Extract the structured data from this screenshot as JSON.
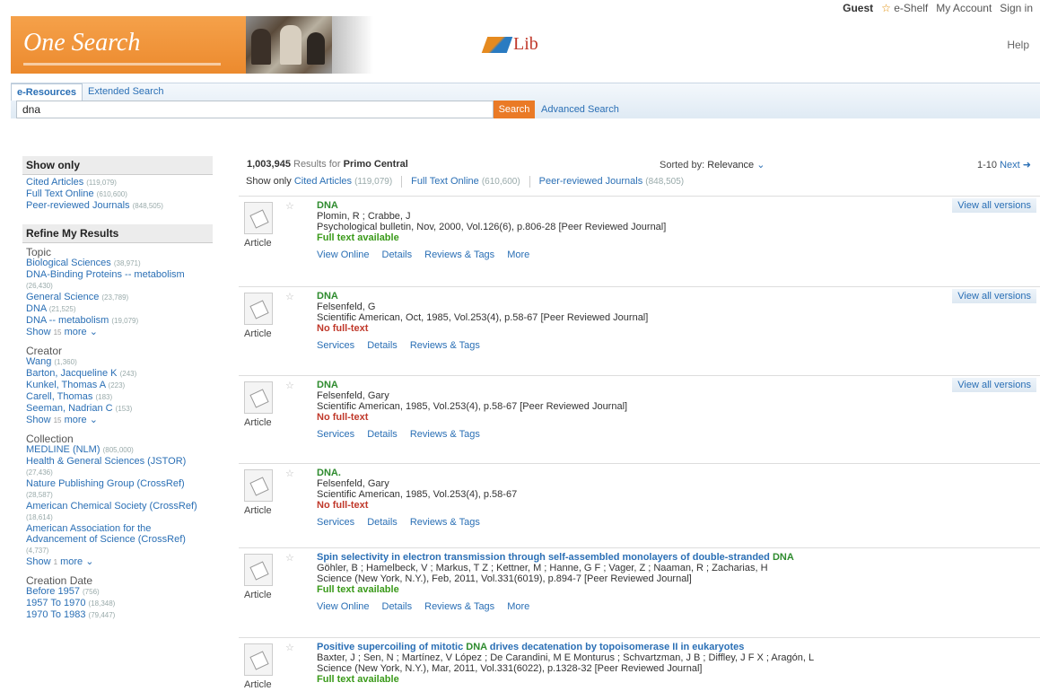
{
  "topnav": {
    "guest": "Guest",
    "eshelf": "e-Shelf",
    "account": "My Account",
    "signin": "Sign in",
    "help": "Help"
  },
  "banner": {
    "title": "One Search",
    "lib": "Lib"
  },
  "search": {
    "tabs": [
      "e-Resources",
      "Extended Search"
    ],
    "query": "dna",
    "button": "Search",
    "advanced": "Advanced Search"
  },
  "sidebar": {
    "show_only": {
      "title": "Show only",
      "items": [
        {
          "label": "Cited Articles",
          "count": "(119,079)"
        },
        {
          "label": "Full Text Online",
          "count": "(610,600)"
        },
        {
          "label": "Peer-reviewed Journals",
          "count": "(848,505)"
        }
      ]
    },
    "refine_title": "Refine My Results",
    "facets": [
      {
        "title": "Topic",
        "items": [
          {
            "label": "Biological Sciences",
            "count": "(38,971)"
          },
          {
            "label": "DNA-Binding Proteins -- metabolism",
            "count": "(26,430)"
          },
          {
            "label": "General Science",
            "count": "(23,789)"
          },
          {
            "label": "DNA",
            "count": "(21,525)"
          },
          {
            "label": "DNA -- metabolism",
            "count": "(19,079)"
          }
        ],
        "show": "Show",
        "n": "15",
        "more": "more"
      },
      {
        "title": "Creator",
        "items": [
          {
            "label": "Wang",
            "count": "(1,360)"
          },
          {
            "label": "Barton, Jacqueline K",
            "count": "(243)"
          },
          {
            "label": "Kunkel, Thomas A",
            "count": "(223)"
          },
          {
            "label": "Carell, Thomas",
            "count": "(183)"
          },
          {
            "label": "Seeman, Nadrian C",
            "count": "(153)"
          }
        ],
        "show": "Show",
        "n": "15",
        "more": "more"
      },
      {
        "title": "Collection",
        "items": [
          {
            "label": "MEDLINE (NLM)",
            "count": "(805,000)"
          },
          {
            "label": "Health & General Sciences (JSTOR)",
            "count": "(27,436)"
          },
          {
            "label": "Nature Publishing Group (CrossRef)",
            "count": "(28,587)"
          },
          {
            "label": "American Chemical Society (CrossRef)",
            "count": "(18,614)"
          },
          {
            "label": "American Association for the Advancement of Science (CrossRef)",
            "count": "(4,737)"
          }
        ],
        "show": "Show",
        "n": "1",
        "more": "more"
      },
      {
        "title": "Creation Date",
        "items": [
          {
            "label": "Before 1957",
            "count": "(756)"
          },
          {
            "label": "1957 To 1970",
            "count": "(18,348)"
          },
          {
            "label": "1970 To 1983",
            "count": "(79,447)"
          }
        ]
      }
    ]
  },
  "results": {
    "count": "1,003,945",
    "results_for": "Results for",
    "source": "Primo Central",
    "sorted_by": "Sorted by:",
    "sort_value": "Relevance",
    "pager": "1-10",
    "next": "Next",
    "show_only": "Show only",
    "filters": [
      {
        "label": "Cited Articles",
        "count": "(119,079)"
      },
      {
        "label": "Full Text Online",
        "count": "(610,600)"
      },
      {
        "label": "Peer-reviewed Journals",
        "count": "(848,505)"
      }
    ],
    "versions": "View all versions",
    "type": "Article",
    "items": [
      {
        "title": "DNA",
        "authors": "Plomin, R ; Crabbe, J",
        "source": "Psychological bulletin, Nov, 2000, Vol.126(6), p.806-28 [Peer Reviewed Journal]",
        "fulltext": "Full text available",
        "available": true,
        "actions": [
          "View Online",
          "Details",
          "Reviews & Tags",
          "More"
        ],
        "versions": true
      },
      {
        "title": "DNA",
        "authors": "Felsenfeld, G",
        "source": "Scientific American, Oct, 1985, Vol.253(4), p.58-67 [Peer Reviewed Journal]",
        "fulltext": "No full-text",
        "available": false,
        "actions": [
          "Services",
          "Details",
          "Reviews & Tags"
        ],
        "versions": true
      },
      {
        "title": "DNA",
        "authors": "Felsenfeld, Gary",
        "source": "Scientific American, 1985, Vol.253(4), p.58-67 [Peer Reviewed Journal]",
        "fulltext": "No full-text",
        "available": false,
        "actions": [
          "Services",
          "Details",
          "Reviews & Tags"
        ],
        "versions": true
      },
      {
        "title": "DNA.",
        "authors": "Felsenfeld, Gary",
        "source": "Scientific American, 1985, Vol.253(4), p.58-67",
        "fulltext": "No full-text",
        "available": false,
        "actions": [
          "Services",
          "Details",
          "Reviews & Tags"
        ],
        "versions": false
      },
      {
        "title_pre": "Spin selectivity in electron transmission through self-assembled monolayers of double-stranded ",
        "title_hl": "DNA",
        "title_post": "",
        "authors": "Göhler, B ; Hamelbeck, V ; Markus, T Z ; Kettner, M ; Hanne, G F ; Vager, Z ; Naaman, R ; Zacharias, H",
        "source": "Science (New York, N.Y.), Feb, 2011, Vol.331(6019), p.894-7 [Peer Reviewed Journal]",
        "fulltext": "Full text available",
        "available": true,
        "actions": [
          "View Online",
          "Details",
          "Reviews & Tags",
          "More"
        ],
        "versions": false
      },
      {
        "title_pre": "Positive supercoiling of mitotic ",
        "title_hl": "DNA",
        "title_post": " drives decatenation by topoisomerase II in eukaryotes",
        "authors": "Baxter, J ; Sen, N ; Martínez, V López ; De Carandini, M E Monturus ; Schvartzman, J B ; Diffley, J F X ; Aragón, L",
        "source": "Science (New York, N.Y.), Mar, 2011, Vol.331(6022), p.1328-32 [Peer Reviewed Journal]",
        "fulltext": "Full text available",
        "available": true,
        "actions": [],
        "versions": false
      }
    ]
  },
  "colors": {
    "accent": "#ea7a26",
    "link": "#2a6fb5",
    "available": "#3a9a1a",
    "unavailable": "#c0392b"
  }
}
